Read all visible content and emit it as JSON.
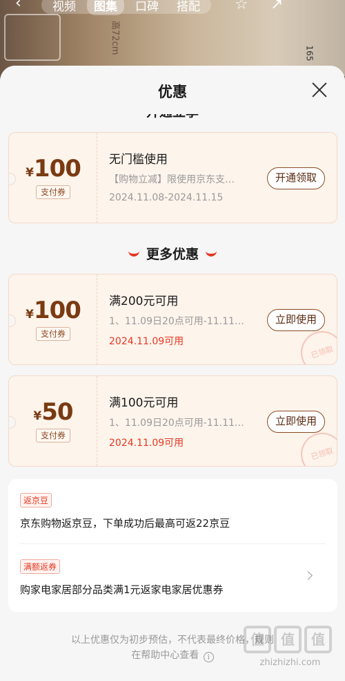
{
  "background": {
    "tabs": [
      "视频",
      "图集",
      "口碑",
      "搭配"
    ],
    "active_tab": "图集",
    "measure_label": "高72cm",
    "side_number": "165"
  },
  "sheet": {
    "title": "优惠",
    "section_top": "开通立享",
    "section_more": "更多优惠"
  },
  "coupons": [
    {
      "currency": "¥",
      "amount": "100",
      "tag": "支付券",
      "title": "无门槛使用",
      "desc": "【购物立减】限使用京东支…",
      "date": "2024.11.08-2024.11.15",
      "button": "开通领取",
      "stamp": ""
    },
    {
      "currency": "¥",
      "amount": "100",
      "tag": "支付券",
      "title": "满200元可用",
      "desc": "1、11.09日20点可用-11.11…",
      "date": "2024.11.09可用",
      "button": "立即使用",
      "stamp": "已领取"
    },
    {
      "currency": "¥",
      "amount": "50",
      "tag": "支付券",
      "title": "满100元可用",
      "desc": "1、11.09日20点可用-11.11…",
      "date": "2024.11.09可用",
      "button": "立即使用",
      "stamp": "已领取"
    }
  ],
  "info": {
    "beans_badge": "返京豆",
    "beans_text": "京东购物返京豆，下单成功后最高可返22京豆",
    "coupon_badge": "满额返券",
    "coupon_text": "购家电家居部分品类满1元返家电家居优惠券"
  },
  "footnote": {
    "line1": "以上优惠仅为初步预估，不代表最终价格，规则",
    "line2": "在帮助中心查看",
    "help_symbol": "i"
  },
  "watermark": {
    "logo_chars": [
      "值",
      "值",
      "值"
    ],
    "domain": "zhizhizhi.com"
  }
}
